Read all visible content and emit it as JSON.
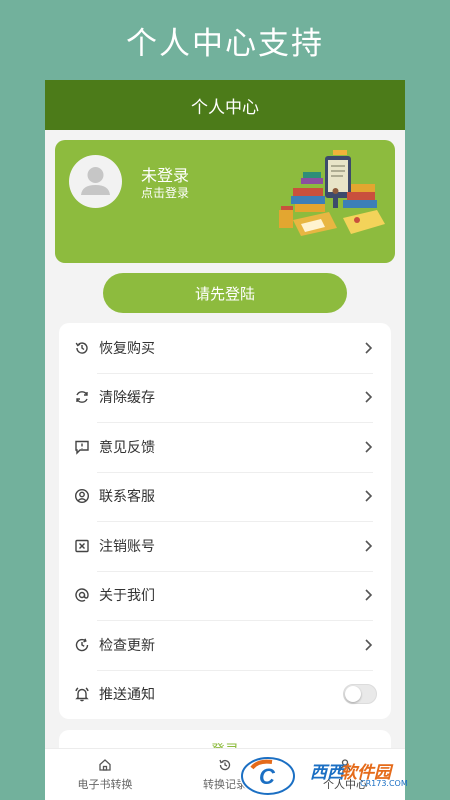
{
  "promo": {
    "title": "个人中心支持"
  },
  "header": {
    "title": "个人中心"
  },
  "profile": {
    "name": "未登录",
    "hint": "点击登录"
  },
  "login_button": "请先登陆",
  "menu": {
    "items": [
      {
        "label": "恢复购买",
        "icon": "restore-icon"
      },
      {
        "label": "清除缓存",
        "icon": "refresh-icon"
      },
      {
        "label": "意见反馈",
        "icon": "feedback-icon"
      },
      {
        "label": "联系客服",
        "icon": "user-circle-icon"
      },
      {
        "label": "注销账号",
        "icon": "close-box-icon"
      },
      {
        "label": "关于我们",
        "icon": "at-icon"
      },
      {
        "label": "检查更新",
        "icon": "clock-icon"
      },
      {
        "label": "推送通知",
        "icon": "bell-icon"
      }
    ],
    "push_enabled": false
  },
  "logout_label": "登录",
  "tabs": [
    {
      "label": "电子书转换",
      "icon": "home-icon"
    },
    {
      "label": "转换记录",
      "icon": "history-icon"
    },
    {
      "label": "个人中心",
      "icon": "person-icon"
    }
  ],
  "watermark": {
    "brand1": "西西",
    "brand2": "软件园",
    "sub": "CR173.COM"
  },
  "colors": {
    "background": "#72b19c",
    "header": "#4c7b19",
    "accent": "#8dbb3e"
  }
}
